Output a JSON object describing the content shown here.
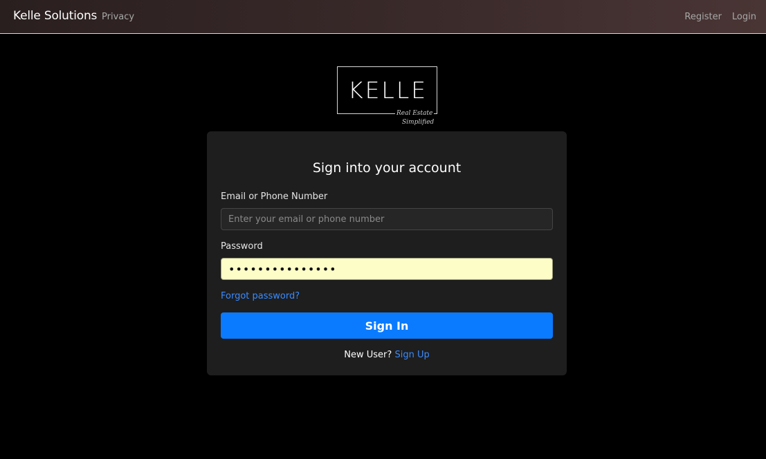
{
  "navbar": {
    "brand": "Kelle Solutions",
    "privacy": "Privacy",
    "register": "Register",
    "login": "Login"
  },
  "logo": {
    "title": "KELLE",
    "line1": "Real Estate",
    "line2": "Simplified"
  },
  "form": {
    "title": "Sign into your account",
    "email_label": "Email or Phone Number",
    "email_placeholder": "Enter your email or phone number",
    "email_value": "",
    "password_label": "Password",
    "password_value": "•••••••••••••••",
    "forgot": "Forgot password?",
    "submit": "Sign In",
    "new_user": "New User?",
    "signup": "Sign Up"
  },
  "colors": {
    "accent": "#0a7bff",
    "link": "#3a8bff",
    "card_bg": "#1e1e1e",
    "autofill_bg": "#fdfdc8"
  }
}
